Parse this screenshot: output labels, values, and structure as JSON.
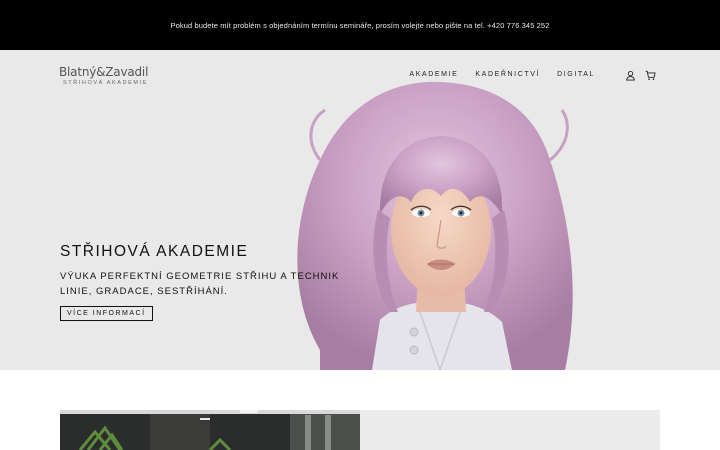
{
  "announcement": {
    "text": "Pokud budete mít problém s objednáním termínu semináře, prosím volejte nebo pište na tel. +420 776 345 252"
  },
  "header": {
    "logo_main": "Blatný&Zavadil",
    "logo_sub": "STŘIHOVÁ AKADEMIE",
    "nav": [
      {
        "label": "AKADEMIE"
      },
      {
        "label": "KADEŘNICTVÍ"
      },
      {
        "label": "DIGITAL"
      }
    ],
    "icons": [
      "user-icon",
      "cart-icon"
    ]
  },
  "hero": {
    "title": "STŘIHOVÁ AKADEMIE",
    "subtitle": "VÝUKA PERFEKTNÍ GEOMETRIE STŘIHU A TECHNIK LINIE, GRADACE, SESTŘÍHÁNÍ.",
    "button_label": "VÍCE INFORMACÍ"
  },
  "colors": {
    "topbar_bg": "#000000",
    "hero_bg": "#e9e9e9",
    "hair": "#c9a3c3",
    "text": "#111111"
  }
}
